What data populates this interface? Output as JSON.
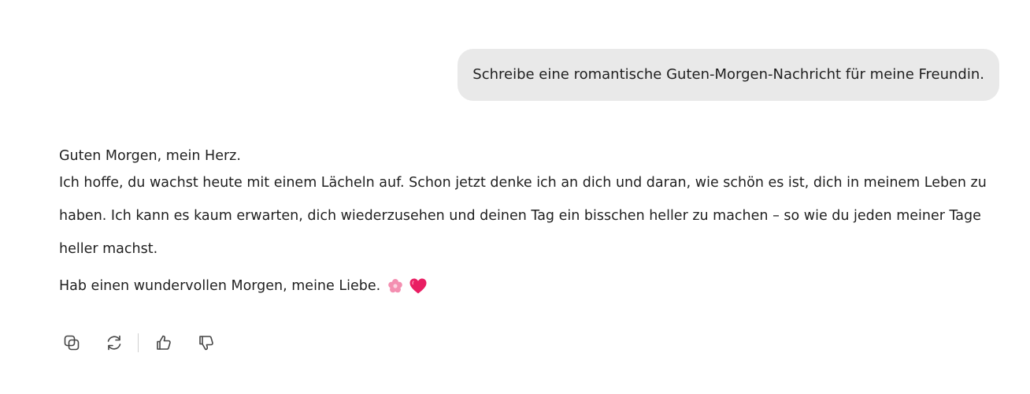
{
  "user_message": {
    "text": "Schreibe eine romantische Guten-Morgen-Nachricht für meine Freundin."
  },
  "assistant_message": {
    "greeting": "Guten Morgen, mein Herz.",
    "body": "Ich hoffe, du wachst heute mit einem Lächeln auf. Schon jetzt denke ich an dich und daran, wie schön es ist, dich in meinem Leben zu haben. Ich kann es kaum erwarten, dich wiederzusehen und deinen Tag ein bisschen heller zu machen – so wie du jeden meiner Tage heller machst.",
    "closing": "Hab einen wundervollen Morgen, meine Liebe.",
    "emojis": [
      "flower-emoji",
      "heart-emoji"
    ]
  },
  "actions": {
    "icons": [
      "copy-icon",
      "regenerate-icon",
      "thumbs-up-icon",
      "thumbs-down-icon"
    ]
  },
  "colors": {
    "user_bubble_bg": "#e9e9e9",
    "text": "#1f1f1f",
    "icon": "#444444",
    "flower": "#f48fb1",
    "heart": "#e91e63"
  }
}
